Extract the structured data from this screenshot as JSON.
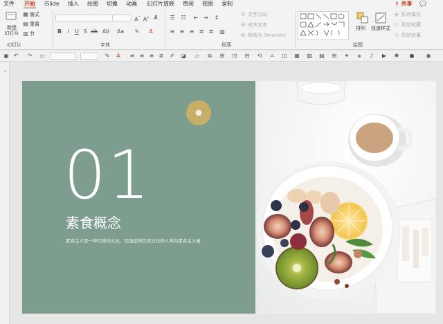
{
  "tabs": [
    {
      "label": "文件"
    },
    {
      "label": "开始",
      "active": true
    },
    {
      "label": "iSlide"
    },
    {
      "label": "插入"
    },
    {
      "label": "绘图"
    },
    {
      "label": "切换"
    },
    {
      "label": "动画"
    },
    {
      "label": "幻灯片放映"
    },
    {
      "label": "审阅"
    },
    {
      "label": "视图"
    },
    {
      "label": "录制"
    }
  ],
  "share_label": "共享",
  "ribbon": {
    "new_slide": "新建\n幻灯片",
    "layout": "版式",
    "reset": "重置",
    "section": "节",
    "group_slides": "幻灯片",
    "group_font": "字体",
    "group_paragraph": "段落",
    "group_drawing": "绘图",
    "text_direction": "文字方向",
    "align_text": "对齐文本",
    "convert_smartart": "转换为 SmartArt",
    "arrange": "排列",
    "quick_styles": "快速样式",
    "shape_fill": "形状填充",
    "shape_outline": "形状轮廓",
    "shape_effects": "形状效果"
  },
  "slide": {
    "number": "01",
    "title": "素食概念",
    "subtitle": "素食主义是一种饮食的文化，实践这种饮食文化的人称为素食主义者"
  },
  "colors": {
    "accent": "#c43e1c",
    "slide_green": "#7d9e8e",
    "cursor": "#d4b260"
  }
}
